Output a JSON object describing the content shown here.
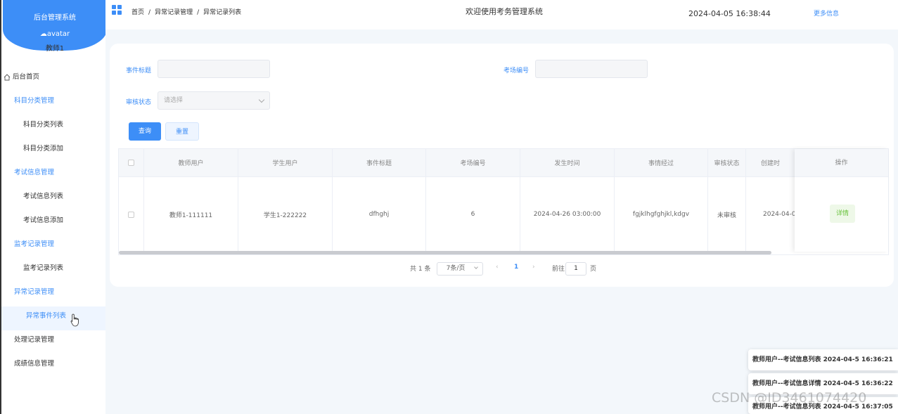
{
  "sidebar": {
    "system_title": "后台管理系统",
    "avatar_alt": "avatar",
    "username": "教师1",
    "items": [
      {
        "label": "后台首页",
        "type": "home"
      },
      {
        "label": "科目分类管理",
        "type": "group"
      },
      {
        "label": "科目分类列表",
        "type": "sub"
      },
      {
        "label": "科目分类添加",
        "type": "sub"
      },
      {
        "label": "考试信息管理",
        "type": "group"
      },
      {
        "label": "考试信息列表",
        "type": "sub"
      },
      {
        "label": "考试信息添加",
        "type": "sub"
      },
      {
        "label": "监考记录管理",
        "type": "group"
      },
      {
        "label": "监考记录列表",
        "type": "sub"
      },
      {
        "label": "异常记录管理",
        "type": "group"
      },
      {
        "label": "异常事件列表",
        "type": "sub-active"
      },
      {
        "label": "处理记录管理",
        "type": "group-dark"
      },
      {
        "label": "成绩信息管理",
        "type": "group-dark"
      }
    ]
  },
  "header": {
    "breadcrumb": [
      "首页",
      "/",
      "异常记录管理",
      "/",
      "异常记录列表"
    ],
    "welcome": "欢迎使用考务管理系统",
    "datetime": "2024-04-05 16:38:44",
    "more_info": "更多信息"
  },
  "search": {
    "title_label": "事件标题",
    "title_value": "",
    "room_label": "考场编号",
    "room_value": "",
    "status_label": "审核状态",
    "status_placeholder": "请选择",
    "query_button": "查询",
    "reset_button": "重置"
  },
  "table": {
    "columns": [
      "教师用户",
      "学生用户",
      "事件标题",
      "考场编号",
      "发生时间",
      "事情经过",
      "审核状态",
      "创建时"
    ],
    "action_column": "操作",
    "rows": [
      {
        "teacher": "教师1-111111",
        "student": "学生1-222222",
        "title": "dfhghj",
        "room": "6",
        "time": "2024-04-26 03:00:00",
        "detail": "fgjklhgfghjkl,kdgv",
        "status": "未审核",
        "created": "2024-04-0",
        "action": "详情"
      }
    ]
  },
  "pagination": {
    "total_text": "共 1 条",
    "page_size": "7条/页",
    "prev": "‹",
    "current_page": "1",
    "next": "›",
    "goto_label": "前往",
    "goto_value": "1",
    "page_suffix": "页"
  },
  "notifications": [
    "教师用户--考试信息列表 2024-04-5 16:36:21",
    "教师用户--考试信息详情 2024-04-5 16:36:22",
    "教师用户--考试信息列表 2024-04-5 16:37:05"
  ],
  "watermark": "CSDN @ID3461074420",
  "colors": {
    "accent": "#3d8ef7",
    "success": "#67c23a",
    "content_bg": "#f3f7fb"
  }
}
